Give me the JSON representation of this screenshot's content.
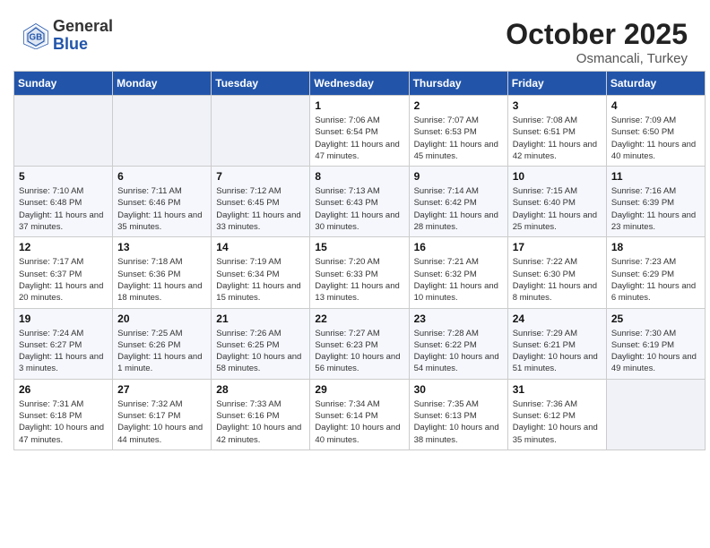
{
  "header": {
    "logo_general": "General",
    "logo_blue": "Blue",
    "month_title": "October 2025",
    "subtitle": "Osmancali, Turkey"
  },
  "days_of_week": [
    "Sunday",
    "Monday",
    "Tuesday",
    "Wednesday",
    "Thursday",
    "Friday",
    "Saturday"
  ],
  "weeks": [
    {
      "days": [
        {
          "number": "",
          "sunrise": "",
          "sunset": "",
          "daylight": "",
          "empty": true
        },
        {
          "number": "",
          "sunrise": "",
          "sunset": "",
          "daylight": "",
          "empty": true
        },
        {
          "number": "",
          "sunrise": "",
          "sunset": "",
          "daylight": "",
          "empty": true
        },
        {
          "number": "1",
          "sunrise": "Sunrise: 7:06 AM",
          "sunset": "Sunset: 6:54 PM",
          "daylight": "Daylight: 11 hours and 47 minutes."
        },
        {
          "number": "2",
          "sunrise": "Sunrise: 7:07 AM",
          "sunset": "Sunset: 6:53 PM",
          "daylight": "Daylight: 11 hours and 45 minutes."
        },
        {
          "number": "3",
          "sunrise": "Sunrise: 7:08 AM",
          "sunset": "Sunset: 6:51 PM",
          "daylight": "Daylight: 11 hours and 42 minutes."
        },
        {
          "number": "4",
          "sunrise": "Sunrise: 7:09 AM",
          "sunset": "Sunset: 6:50 PM",
          "daylight": "Daylight: 11 hours and 40 minutes."
        }
      ]
    },
    {
      "days": [
        {
          "number": "5",
          "sunrise": "Sunrise: 7:10 AM",
          "sunset": "Sunset: 6:48 PM",
          "daylight": "Daylight: 11 hours and 37 minutes."
        },
        {
          "number": "6",
          "sunrise": "Sunrise: 7:11 AM",
          "sunset": "Sunset: 6:46 PM",
          "daylight": "Daylight: 11 hours and 35 minutes."
        },
        {
          "number": "7",
          "sunrise": "Sunrise: 7:12 AM",
          "sunset": "Sunset: 6:45 PM",
          "daylight": "Daylight: 11 hours and 33 minutes."
        },
        {
          "number": "8",
          "sunrise": "Sunrise: 7:13 AM",
          "sunset": "Sunset: 6:43 PM",
          "daylight": "Daylight: 11 hours and 30 minutes."
        },
        {
          "number": "9",
          "sunrise": "Sunrise: 7:14 AM",
          "sunset": "Sunset: 6:42 PM",
          "daylight": "Daylight: 11 hours and 28 minutes."
        },
        {
          "number": "10",
          "sunrise": "Sunrise: 7:15 AM",
          "sunset": "Sunset: 6:40 PM",
          "daylight": "Daylight: 11 hours and 25 minutes."
        },
        {
          "number": "11",
          "sunrise": "Sunrise: 7:16 AM",
          "sunset": "Sunset: 6:39 PM",
          "daylight": "Daylight: 11 hours and 23 minutes."
        }
      ]
    },
    {
      "days": [
        {
          "number": "12",
          "sunrise": "Sunrise: 7:17 AM",
          "sunset": "Sunset: 6:37 PM",
          "daylight": "Daylight: 11 hours and 20 minutes."
        },
        {
          "number": "13",
          "sunrise": "Sunrise: 7:18 AM",
          "sunset": "Sunset: 6:36 PM",
          "daylight": "Daylight: 11 hours and 18 minutes."
        },
        {
          "number": "14",
          "sunrise": "Sunrise: 7:19 AM",
          "sunset": "Sunset: 6:34 PM",
          "daylight": "Daylight: 11 hours and 15 minutes."
        },
        {
          "number": "15",
          "sunrise": "Sunrise: 7:20 AM",
          "sunset": "Sunset: 6:33 PM",
          "daylight": "Daylight: 11 hours and 13 minutes."
        },
        {
          "number": "16",
          "sunrise": "Sunrise: 7:21 AM",
          "sunset": "Sunset: 6:32 PM",
          "daylight": "Daylight: 11 hours and 10 minutes."
        },
        {
          "number": "17",
          "sunrise": "Sunrise: 7:22 AM",
          "sunset": "Sunset: 6:30 PM",
          "daylight": "Daylight: 11 hours and 8 minutes."
        },
        {
          "number": "18",
          "sunrise": "Sunrise: 7:23 AM",
          "sunset": "Sunset: 6:29 PM",
          "daylight": "Daylight: 11 hours and 6 minutes."
        }
      ]
    },
    {
      "days": [
        {
          "number": "19",
          "sunrise": "Sunrise: 7:24 AM",
          "sunset": "Sunset: 6:27 PM",
          "daylight": "Daylight: 11 hours and 3 minutes."
        },
        {
          "number": "20",
          "sunrise": "Sunrise: 7:25 AM",
          "sunset": "Sunset: 6:26 PM",
          "daylight": "Daylight: 11 hours and 1 minute."
        },
        {
          "number": "21",
          "sunrise": "Sunrise: 7:26 AM",
          "sunset": "Sunset: 6:25 PM",
          "daylight": "Daylight: 10 hours and 58 minutes."
        },
        {
          "number": "22",
          "sunrise": "Sunrise: 7:27 AM",
          "sunset": "Sunset: 6:23 PM",
          "daylight": "Daylight: 10 hours and 56 minutes."
        },
        {
          "number": "23",
          "sunrise": "Sunrise: 7:28 AM",
          "sunset": "Sunset: 6:22 PM",
          "daylight": "Daylight: 10 hours and 54 minutes."
        },
        {
          "number": "24",
          "sunrise": "Sunrise: 7:29 AM",
          "sunset": "Sunset: 6:21 PM",
          "daylight": "Daylight: 10 hours and 51 minutes."
        },
        {
          "number": "25",
          "sunrise": "Sunrise: 7:30 AM",
          "sunset": "Sunset: 6:19 PM",
          "daylight": "Daylight: 10 hours and 49 minutes."
        }
      ]
    },
    {
      "days": [
        {
          "number": "26",
          "sunrise": "Sunrise: 7:31 AM",
          "sunset": "Sunset: 6:18 PM",
          "daylight": "Daylight: 10 hours and 47 minutes."
        },
        {
          "number": "27",
          "sunrise": "Sunrise: 7:32 AM",
          "sunset": "Sunset: 6:17 PM",
          "daylight": "Daylight: 10 hours and 44 minutes."
        },
        {
          "number": "28",
          "sunrise": "Sunrise: 7:33 AM",
          "sunset": "Sunset: 6:16 PM",
          "daylight": "Daylight: 10 hours and 42 minutes."
        },
        {
          "number": "29",
          "sunrise": "Sunrise: 7:34 AM",
          "sunset": "Sunset: 6:14 PM",
          "daylight": "Daylight: 10 hours and 40 minutes."
        },
        {
          "number": "30",
          "sunrise": "Sunrise: 7:35 AM",
          "sunset": "Sunset: 6:13 PM",
          "daylight": "Daylight: 10 hours and 38 minutes."
        },
        {
          "number": "31",
          "sunrise": "Sunrise: 7:36 AM",
          "sunset": "Sunset: 6:12 PM",
          "daylight": "Daylight: 10 hours and 35 minutes."
        },
        {
          "number": "",
          "sunrise": "",
          "sunset": "",
          "daylight": "",
          "empty": true
        }
      ]
    }
  ]
}
